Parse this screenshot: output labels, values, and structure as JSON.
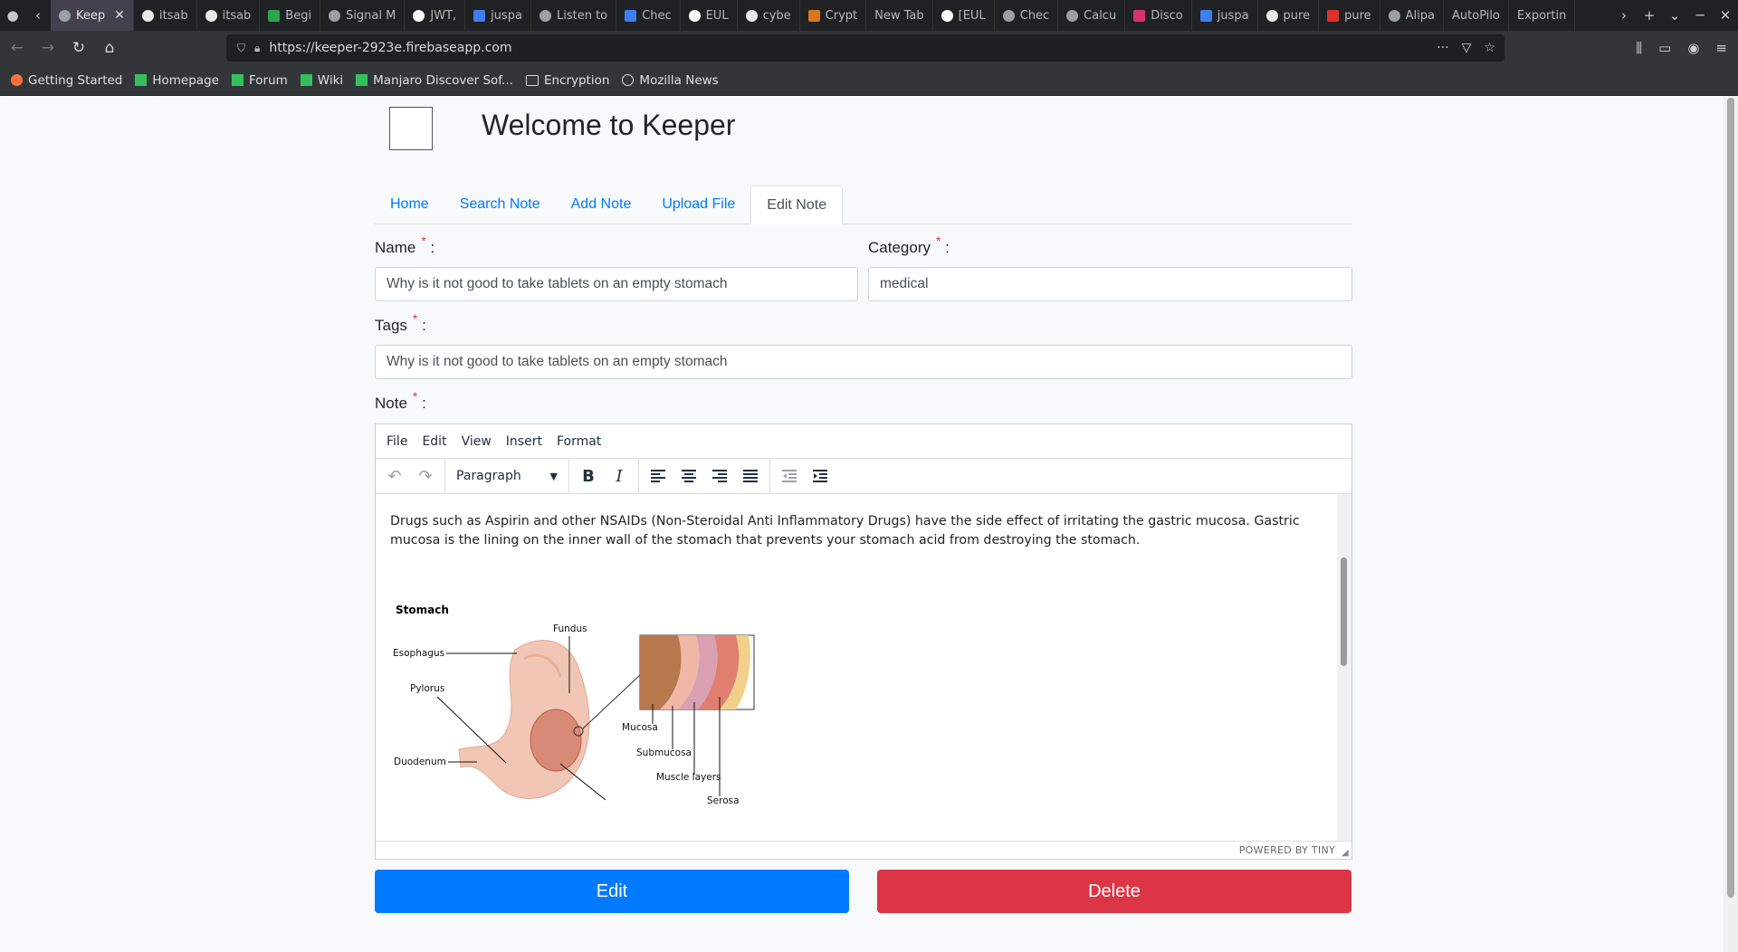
{
  "browser": {
    "tabs": [
      {
        "label": "Keep",
        "icon": "keeper-icon",
        "active": true
      },
      {
        "label": "itsab",
        "icon": "github-icon"
      },
      {
        "label": "itsab",
        "icon": "github-icon"
      },
      {
        "label": "Begi",
        "icon": "triangle-icon"
      },
      {
        "label": "Signal M",
        "icon": "signal-icon"
      },
      {
        "label": "JWT,",
        "icon": "jwt-icon"
      },
      {
        "label": "juspa",
        "icon": "jira-icon"
      },
      {
        "label": "Listen to",
        "icon": "listen-icon"
      },
      {
        "label": "Chec",
        "icon": "docs-icon"
      },
      {
        "label": "EUL",
        "icon": "eul-icon"
      },
      {
        "label": "cybe",
        "icon": "github-icon"
      },
      {
        "label": "Crypt",
        "icon": "crypto-icon"
      },
      {
        "label": "New Tab",
        "icon": ""
      },
      {
        "label": "[EUL",
        "icon": "eul-icon"
      },
      {
        "label": "Chec",
        "icon": "c-icon"
      },
      {
        "label": "Calcu",
        "icon": "c-icon"
      },
      {
        "label": "Disco",
        "icon": "disco-icon"
      },
      {
        "label": "juspa",
        "icon": "jira-icon"
      },
      {
        "label": "pure",
        "icon": "github-icon"
      },
      {
        "label": "pure",
        "icon": "npm-icon"
      },
      {
        "label": "Alipa",
        "icon": "c-icon"
      },
      {
        "label": "AutoPilo",
        "icon": ""
      },
      {
        "label": "Exportin",
        "icon": ""
      }
    ],
    "url": "https://keeper-2923e.firebaseapp.com",
    "bookmarks": [
      {
        "label": "Getting Started",
        "icon": "firefox-icon"
      },
      {
        "label": "Homepage",
        "icon": "manjaro-icon"
      },
      {
        "label": "Forum",
        "icon": "manjaro-icon"
      },
      {
        "label": "Wiki",
        "icon": "manjaro-icon"
      },
      {
        "label": "Manjaro Discover Sof...",
        "icon": "manjaro-icon"
      },
      {
        "label": "Encryption",
        "icon": "folder-icon"
      },
      {
        "label": "Mozilla News",
        "icon": "globe-icon"
      }
    ]
  },
  "page": {
    "title": "Welcome to Keeper",
    "nav": [
      "Home",
      "Search Note",
      "Add Note",
      "Upload File",
      "Edit Note"
    ],
    "active_nav": "Edit Note",
    "form": {
      "name_label": "Name",
      "name_value": "Why is it not good to take tablets on an empty stomach",
      "category_label": "Category",
      "category_value": "medical",
      "tags_label": "Tags",
      "tags_value": "Why is it not good to take tablets on an empty stomach",
      "note_label": "Note",
      "required_mark": "*",
      "colon": ":"
    },
    "editor": {
      "menu": [
        "File",
        "Edit",
        "View",
        "Insert",
        "Format"
      ],
      "block_format": "Paragraph",
      "content": "Drugs such as Aspirin and other NSAIDs (Non-Steroidal Anti Inflammatory Drugs) have the side effect of irritating the gastric mucosa. Gastric mucosa is the lining on the inner wall of the stomach that prevents your stomach acid from destroying the stomach.",
      "status": "POWERED BY TINY",
      "figure": {
        "title": "Stomach",
        "labels": [
          "Fundus",
          "Esophagus",
          "Pylorus",
          "Duodenum",
          "Mucosa",
          "Submucosa",
          "Muscle layers",
          "Serosa"
        ]
      }
    },
    "buttons": {
      "edit": "Edit",
      "delete": "Delete"
    },
    "colors": {
      "primary": "#007bff",
      "danger": "#dc3545",
      "link": "#007bff"
    }
  }
}
